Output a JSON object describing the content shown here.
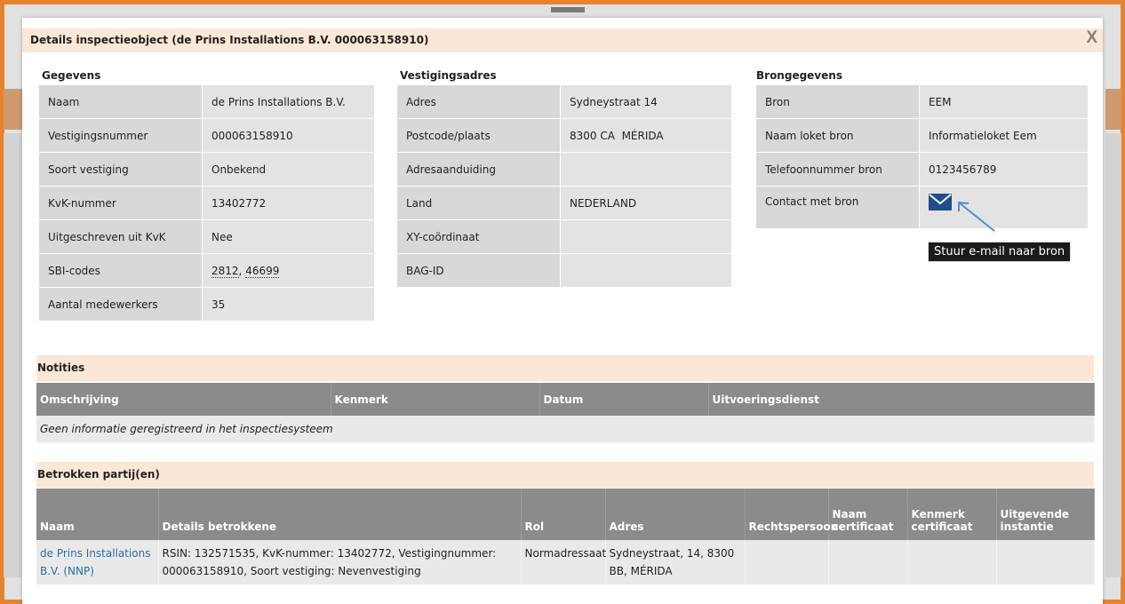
{
  "dialog": {
    "title": "Details inspectieobject (de Prins Installations B.V. 000063158910)",
    "close_label": "X"
  },
  "gegevens": {
    "heading": "Gegevens",
    "rows": [
      {
        "label": "Naam",
        "value": "de Prins Installations B.V."
      },
      {
        "label": "Vestigingsnummer",
        "value": "000063158910"
      },
      {
        "label": "Soort vestiging",
        "value": "Onbekend"
      },
      {
        "label": "KvK-nummer",
        "value": "13402772"
      },
      {
        "label": "Uitgeschreven uit KvK",
        "value": "Nee"
      },
      {
        "label": "SBI-codes",
        "value": "",
        "codes": [
          "2812",
          "46699"
        ]
      },
      {
        "label": "Aantal medewerkers",
        "value": "35"
      }
    ]
  },
  "vestigingsadres": {
    "heading": "Vestigingsadres",
    "rows": [
      {
        "label": "Adres",
        "value": "Sydneystraat 14"
      },
      {
        "label": "Postcode/plaats",
        "value": "8300 CA  MÉRIDA"
      },
      {
        "label": "Adresaanduiding",
        "value": ""
      },
      {
        "label": "Land",
        "value": "NEDERLAND"
      },
      {
        "label": "XY-coördinaat",
        "value": ""
      },
      {
        "label": "BAG-ID",
        "value": ""
      }
    ]
  },
  "brongegevens": {
    "heading": "Brongegevens",
    "rows": [
      {
        "label": "Bron",
        "value": "EEM"
      },
      {
        "label": "Naam loket bron",
        "value": "Informatieloket Eem"
      },
      {
        "label": "Telefoonnummer bron",
        "value": "0123456789"
      },
      {
        "label": "Contact met bron",
        "value": ""
      }
    ],
    "mail_icon": "envelope-icon",
    "tooltip": "Stuur e-mail naar bron"
  },
  "notities": {
    "heading": "Notities",
    "columns": [
      "Omschrijving",
      "Kenmerk",
      "Datum",
      "Uitvoeringsdienst"
    ],
    "empty_text": "Geen informatie geregistreerd in het inspectiesysteem"
  },
  "partijen": {
    "heading": "Betrokken partij(en)",
    "columns": [
      "Naam",
      "Details betrokkene",
      "Rol",
      "Adres",
      "Rechtspersoon",
      "Naam certificaat",
      "Kenmerk certificaat",
      "Uitgevende instantie"
    ],
    "rows": [
      {
        "naam": "de Prins Installations B.V. (NNP)",
        "details": "RSIN: 132571535, KvK-nummer: 13402772, Vestigingnummer: 000063158910, Soort vestiging: Nevenvestiging",
        "rol": "Normadressaat",
        "adres": "Sydneystraat, 14, 8300 BB, MÉRIDA",
        "rechtspersoon": "",
        "naam_certificaat": "",
        "kenmerk_certificaat": "",
        "uitgevende_instantie": ""
      }
    ]
  },
  "colors": {
    "frame": "#e8822c",
    "section_bar": "#fbe7d6",
    "table_header": "#8b8b8b",
    "link": "#2a6ca5",
    "icon": "#1f4e8c"
  }
}
